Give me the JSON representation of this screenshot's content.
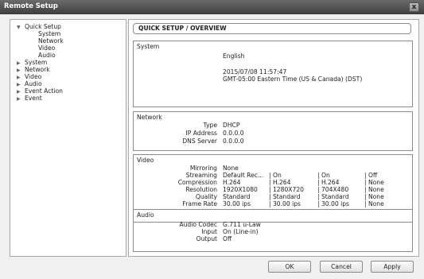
{
  "window": {
    "title": "Remote Setup",
    "close_label": "x"
  },
  "tree": {
    "items": [
      {
        "label": "Quick Setup",
        "arrow": "▼"
      },
      {
        "label": "System",
        "arrow": ""
      },
      {
        "label": "Network",
        "arrow": ""
      },
      {
        "label": "Video",
        "arrow": ""
      },
      {
        "label": "Audio",
        "arrow": ""
      },
      {
        "label": "System",
        "arrow": "▶"
      },
      {
        "label": "Network",
        "arrow": "▶"
      },
      {
        "label": "Video",
        "arrow": "▶"
      },
      {
        "label": "Audio",
        "arrow": "▶"
      },
      {
        "label": "Event Action",
        "arrow": "▶"
      },
      {
        "label": "Event",
        "arrow": "▶"
      }
    ]
  },
  "header": {
    "title": "QUICK SETUP / OVERVIEW"
  },
  "system": {
    "title": "System",
    "language": "English",
    "datetime": "2015/07/08 11:57:47",
    "timezone": "GMT-05:00 Eastern Time (US & Canada) (DST)"
  },
  "network": {
    "title": "Network",
    "rows": [
      {
        "label": "Type",
        "value": "DHCP"
      },
      {
        "label": "IP Address",
        "value": "0.0.0.0"
      },
      {
        "label": "DNS Server",
        "value": "0.0.0.0"
      }
    ]
  },
  "video": {
    "title": "Video",
    "mirroring_label": "Mirroring",
    "mirroring_value": "None",
    "rows": [
      {
        "label": "Streaming",
        "cols": [
          "Default Rec...",
          "| On",
          "| On",
          "| Off"
        ]
      },
      {
        "label": "Compression",
        "cols": [
          "H.264",
          "| H.264",
          "| H.264",
          "| None"
        ]
      },
      {
        "label": "Resolution",
        "cols": [
          "1920X1080",
          "| 1280X720",
          "| 704X480",
          "| None"
        ]
      },
      {
        "label": "Quality",
        "cols": [
          "Standard",
          "| Standard",
          "| Standard",
          "| None"
        ]
      },
      {
        "label": "Frame Rate",
        "cols": [
          "30.00 ips",
          "| 30.00 ips",
          "| 30.00 ips",
          "| None"
        ]
      }
    ]
  },
  "audio": {
    "title": "Audio",
    "rows": [
      {
        "label": "Audio Codec",
        "value": "G.711 u-Law"
      },
      {
        "label": "Input",
        "value": "On (Line-in)"
      },
      {
        "label": "Output",
        "value": "Off"
      }
    ]
  },
  "buttons": {
    "ok": "OK",
    "cancel": "Cancel",
    "apply": "Apply"
  }
}
